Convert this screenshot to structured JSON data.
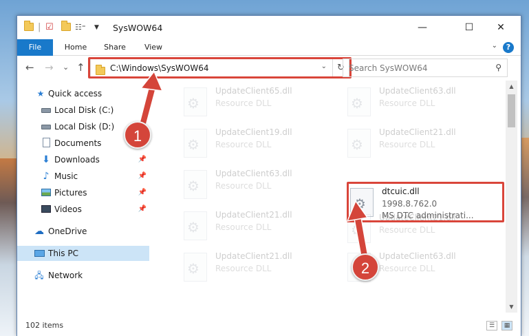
{
  "window": {
    "title": "SysWOW64",
    "controls": {
      "minimize": "—",
      "maximize": "☐",
      "close": "✕"
    }
  },
  "ribbon": {
    "tabs": [
      "File",
      "Home",
      "Share",
      "View"
    ],
    "help": "?"
  },
  "navigation": {
    "back": "←",
    "forward": "→",
    "recent": "⌄",
    "up": "↑",
    "address": "C:\\Windows\\SysWOW64",
    "search_placeholder": "Search SysWOW64"
  },
  "sidebar": {
    "items": [
      {
        "label": "Quick access",
        "icon": "star-icon",
        "pinned": false
      },
      {
        "label": "Local Disk (C:)",
        "icon": "disk-icon",
        "pinned": false
      },
      {
        "label": "Local Disk (D:)",
        "icon": "disk-icon",
        "pinned": false
      },
      {
        "label": "Documents",
        "icon": "documents-icon",
        "pinned": false
      },
      {
        "label": "Downloads",
        "icon": "downloads-icon",
        "pinned": true
      },
      {
        "label": "Music",
        "icon": "music-icon",
        "pinned": true
      },
      {
        "label": "Pictures",
        "icon": "pictures-icon",
        "pinned": true
      },
      {
        "label": "Videos",
        "icon": "videos-icon",
        "pinned": true
      },
      {
        "label": "OneDrive",
        "icon": "cloud-icon",
        "pinned": false
      },
      {
        "label": "This PC",
        "icon": "pc-icon",
        "pinned": false,
        "selected": true
      },
      {
        "label": "Network",
        "icon": "network-icon",
        "pinned": false
      }
    ]
  },
  "files": [
    {
      "name": "UpdateClient65.dll",
      "version": "Resource DLL",
      "desc": "",
      "faded": true
    },
    {
      "name": "UpdateClient63.dll",
      "version": "Resource DLL",
      "desc": "",
      "faded": true
    },
    {
      "name": "UpdateClient19.dll",
      "version": "Resource DLL",
      "desc": "",
      "faded": true
    },
    {
      "name": "UpdateClient21.dll",
      "version": "Resource DLL",
      "desc": "",
      "faded": true
    },
    {
      "name": "UpdateClient63.dll",
      "version": "Resource DLL",
      "desc": "",
      "faded": true
    },
    {
      "name": "dtcuic.dll",
      "version": "1998.8.762.0",
      "desc": "MS DTC administrati...",
      "faded": false
    },
    {
      "name": "UpdateClient21.dll",
      "version": "Resource DLL",
      "desc": "",
      "faded": true
    },
    {
      "name": "UpdateClient21.dll",
      "version": "Resource DLL",
      "desc": "",
      "faded": true
    },
    {
      "name": "UpdateClient21.dll",
      "version": "Resource DLL",
      "desc": "",
      "faded": true
    },
    {
      "name": "UpdateClient63.dll",
      "version": "Resource DLL",
      "desc": "",
      "faded": true
    }
  ],
  "status": {
    "item_count": "102 items"
  },
  "annotations": {
    "step1": "1",
    "step2": "2",
    "color": "#d4453a"
  }
}
